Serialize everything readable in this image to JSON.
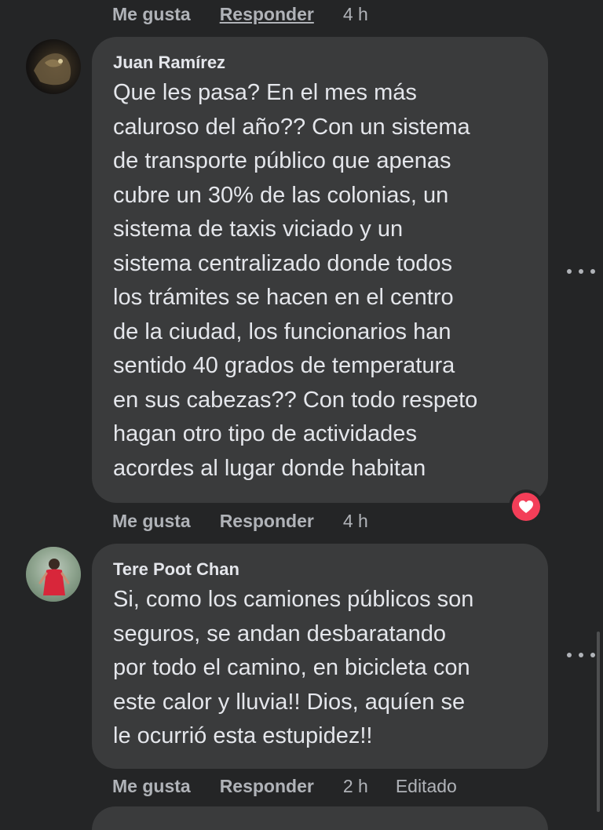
{
  "thread": {
    "top_actions": {
      "like_label": "Me gusta",
      "reply_label": "Responder",
      "time": "4 h"
    },
    "comments": [
      {
        "author": "Juan Ramírez",
        "text": "Que les pasa? En el mes más\ncaluroso del año?? Con un sistema\nde transporte público que apenas\ncubre un 30% de las colonias, un\nsistema de taxis viciado y un\nsistema centralizado donde todos\nlos trámites se hacen en el centro\nde la ciudad, los funcionarios han\nsentido 40 grados de temperatura\nen sus cabezas?? Con todo respeto\nhagan otro tipo de actividades\nacordes al lugar donde habitan",
        "reaction": "heart-icon",
        "actions": {
          "like_label": "Me gusta",
          "reply_label": "Responder",
          "time": "4 h"
        }
      },
      {
        "author": "Tere Poot Chan",
        "text": "Si, como los camiones públicos son\nseguros, se andan desbaratando\npor todo el camino, en bicicleta con\neste calor y lluvia!! Dios, aquíen se\nle ocurrió esta estupidez!!",
        "actions": {
          "like_label": "Me gusta",
          "reply_label": "Responder",
          "time": "2 h",
          "edited_label": "Editado"
        }
      }
    ]
  },
  "colors": {
    "background": "#242526",
    "bubble": "#3a3b3c",
    "text": "#e4e6eb",
    "secondary_text": "#b0b3b8",
    "love_reaction": "#f33e58"
  }
}
